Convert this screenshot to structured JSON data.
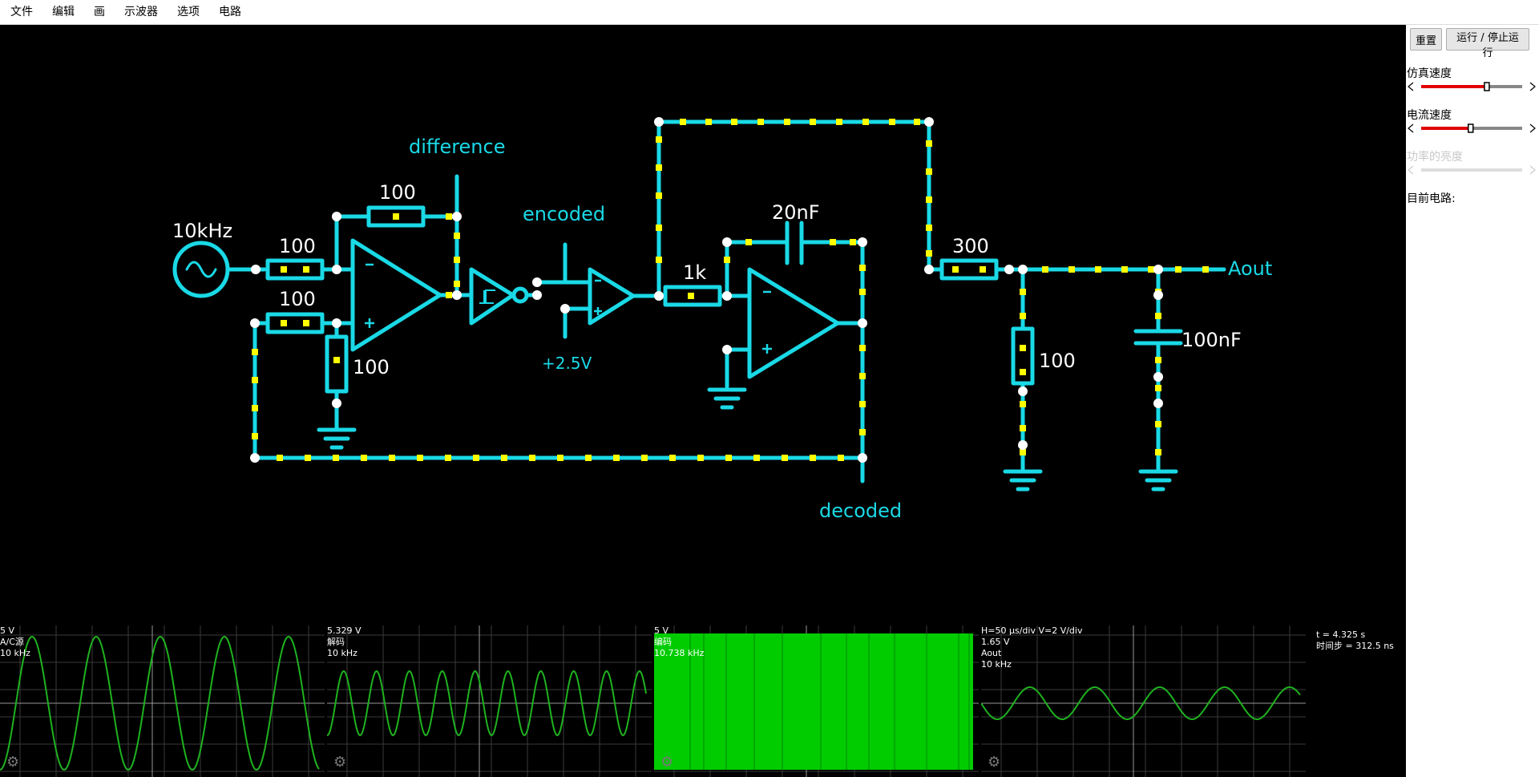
{
  "menu": {
    "items": [
      "文件",
      "编辑",
      "画",
      "示波器",
      "选项",
      "电路"
    ]
  },
  "sidebar": {
    "reset_label": "重置",
    "run_label": "运行 / 停止运行",
    "sim_speed_label": "仿真速度",
    "sim_speed_value": 0.65,
    "current_speed_label": "电流速度",
    "current_speed_value": 0.49,
    "power_brightness_label": "功率的亮度",
    "current_circuit_label": "目前电路:"
  },
  "circuit": {
    "labels": {
      "source_freq": "10kHz",
      "r_in1": "100",
      "r_in2": "100",
      "r_feedback": "100",
      "r_ground": "100",
      "difference": "difference",
      "encoded": "encoded",
      "ref_voltage": "+2.5V",
      "r_integrator": "1k",
      "c_integrator": "20nF",
      "decoded": "decoded",
      "r_filter": "300",
      "r_load": "100",
      "c_filter": "100nF",
      "aout": "Aout"
    },
    "colors": {
      "wire": "#1ad9e6",
      "current_dot": "#ffff00",
      "label_cyan": "#1ad9e6",
      "label_white": "#ffffff"
    }
  },
  "scopes": [
    {
      "lines": [
        "5 V",
        "A/C源",
        "10 kHz"
      ]
    },
    {
      "lines": [
        "5.329 V",
        "解码",
        "10 kHz"
      ]
    },
    {
      "lines": [
        "5 V",
        "编码",
        "10.738 kHz"
      ]
    },
    {
      "lines": [
        "H=50 μs/div V=2 V/div",
        "1.65 V",
        "Aout",
        "10 kHz"
      ]
    }
  ],
  "status": {
    "time": "t = 4.325 s",
    "timestep": "时间步 = 312.5 ns"
  },
  "icons": {
    "scope_settings": "gear-icon",
    "slider_left": "chevron-left-icon",
    "slider_right": "chevron-right-icon"
  },
  "scope_color": "#1fb21f"
}
